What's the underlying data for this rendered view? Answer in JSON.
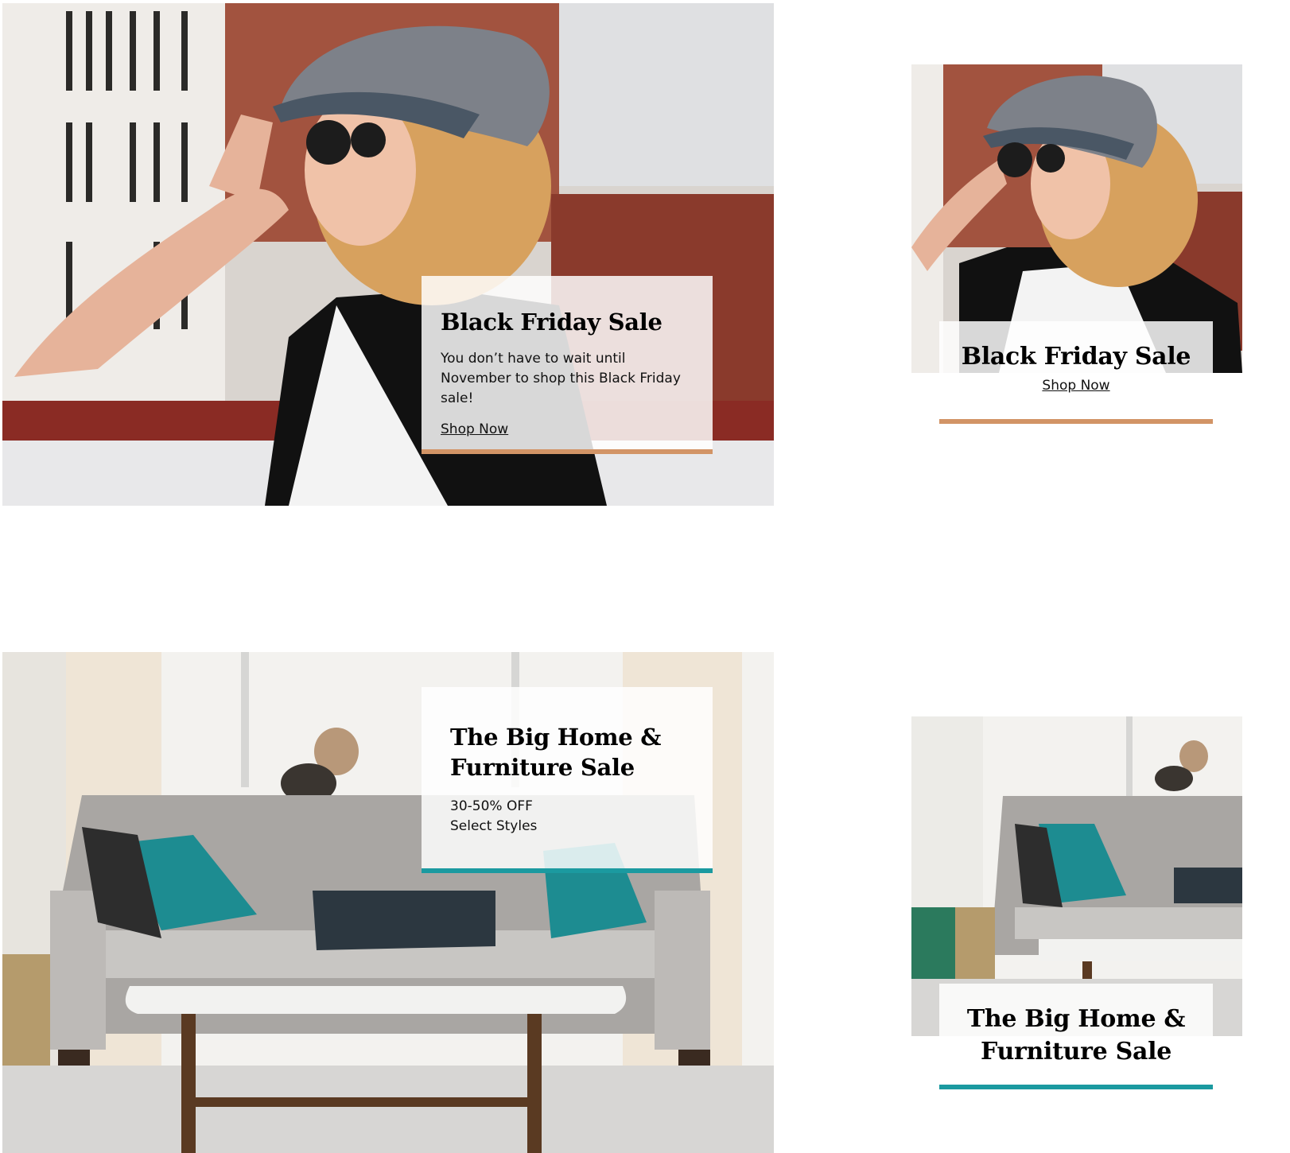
{
  "colors": {
    "black_friday_accent": "#d29466",
    "home_sale_accent": "#1b9aa0"
  },
  "banners": [
    {
      "variant": "desktop",
      "image": "woman-in-cap-and-sunglasses-photo",
      "title": "Black Friday Sale",
      "body": "You don’t have to wait until November to shop this Black Friday sale!",
      "link": "Shop Now"
    },
    {
      "variant": "mobile",
      "image": "woman-in-cap-and-sunglasses-photo",
      "title": "Black Friday Sale",
      "link": "Shop Now"
    },
    {
      "variant": "desktop",
      "image": "living-room-sofa-with-cat-photo",
      "title": "The Big Home & Furniture Sale",
      "title_lines": [
        "The Big Home &",
        "Furniture Sale"
      ],
      "body_lines": [
        "30-50% OFF",
        "Select Styles"
      ]
    },
    {
      "variant": "mobile",
      "image": "living-room-sofa-with-cat-photo",
      "title_lines": [
        "The Big Home &",
        "Furniture Sale"
      ]
    }
  ]
}
